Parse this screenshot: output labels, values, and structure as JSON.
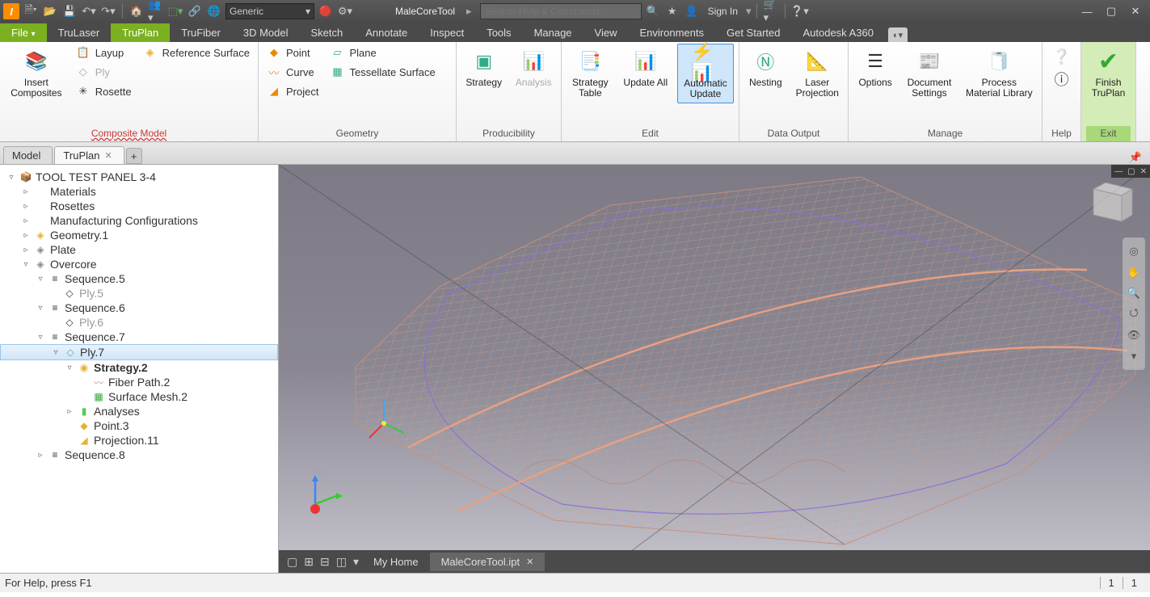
{
  "titlebar": {
    "material_dd": "Generic",
    "doc_title": "MaleCoreTool",
    "search_ph": "Search Help & Commands...",
    "signin": "Sign In"
  },
  "menu": {
    "file": "File",
    "tabs": [
      "TruLaser",
      "TruPlan",
      "TruFiber",
      "3D Model",
      "Sketch",
      "Annotate",
      "Inspect",
      "Tools",
      "Manage",
      "View",
      "Environments",
      "Get Started",
      "Autodesk A360"
    ],
    "active_idx": 1
  },
  "ribbon": {
    "panels": [
      {
        "title": "Composite Model",
        "under": true,
        "items": {
          "insert": "Insert\nComposites",
          "layup": "Layup",
          "refsurf": "Reference Surface",
          "ply": "Ply",
          "rosette": "Rosette"
        }
      },
      {
        "title": "Geometry",
        "items": {
          "point": "Point",
          "plane": "Plane",
          "curve": "Curve",
          "tess": "Tessellate Surface",
          "project": "Project"
        }
      },
      {
        "title": "Producibility",
        "items": {
          "strategy": "Strategy",
          "analysis": "Analysis"
        }
      },
      {
        "title": "Edit",
        "items": {
          "stable": "Strategy\nTable",
          "updall": "Update All",
          "auto": "Automatic\nUpdate"
        }
      },
      {
        "title": "Data Output",
        "items": {
          "nest": "Nesting",
          "laser": "Laser\nProjection"
        }
      },
      {
        "title": "Manage",
        "items": {
          "opts": "Options",
          "docset": "Document\nSettings",
          "matlib": "Process\nMaterial Library"
        }
      },
      {
        "title": "Help"
      },
      {
        "title": "Exit",
        "items": {
          "finish": "Finish\nTruPlan"
        }
      }
    ]
  },
  "doctabs": {
    "model": "Model",
    "truplan": "TruPlan"
  },
  "tree": [
    {
      "d": 0,
      "e": "▿",
      "i": "📦",
      "t": "TOOL TEST PANEL 3-4",
      "bold": false
    },
    {
      "d": 1,
      "e": "▹",
      "i": "",
      "t": "Materials"
    },
    {
      "d": 1,
      "e": "▹",
      "i": "",
      "t": "Rosettes"
    },
    {
      "d": 1,
      "e": "▹",
      "i": "",
      "t": "Manufacturing Configurations"
    },
    {
      "d": 1,
      "e": "▹",
      "i": "◈",
      "t": "Geometry.1",
      "ic": "#e8b030"
    },
    {
      "d": 1,
      "e": "▹",
      "i": "◈",
      "t": "Plate",
      "ic": "#888"
    },
    {
      "d": 1,
      "e": "▿",
      "i": "◈",
      "t": "Overcore",
      "ic": "#888"
    },
    {
      "d": 2,
      "e": "▿",
      "i": "≡",
      "t": "Sequence.5"
    },
    {
      "d": 3,
      "e": "",
      "i": "◇",
      "t": "Ply.5",
      "dim": true
    },
    {
      "d": 2,
      "e": "▿",
      "i": "≡",
      "t": "Sequence.6"
    },
    {
      "d": 3,
      "e": "",
      "i": "◇",
      "t": "Ply.6",
      "dim": true
    },
    {
      "d": 2,
      "e": "▿",
      "i": "≡",
      "t": "Sequence.7"
    },
    {
      "d": 3,
      "e": "▿",
      "i": "◇",
      "t": "Ply.7",
      "sel": true,
      "ic": "#5aa"
    },
    {
      "d": 4,
      "e": "▿",
      "i": "◉",
      "t": "Strategy.2",
      "bold": true,
      "ic": "#e8b030"
    },
    {
      "d": 5,
      "e": "",
      "i": "〰",
      "t": "Fiber Path.2",
      "ic": "#d88"
    },
    {
      "d": 5,
      "e": "",
      "i": "▦",
      "t": "Surface Mesh.2",
      "ic": "#3a3"
    },
    {
      "d": 4,
      "e": "▹",
      "i": "▮",
      "t": "Analyses",
      "ic": "#5c5"
    },
    {
      "d": 4,
      "e": "",
      "i": "◆",
      "t": "Point.3",
      "ic": "#e8b030"
    },
    {
      "d": 4,
      "e": "",
      "i": "◢",
      "t": "Projection.11",
      "ic": "#e8b030"
    },
    {
      "d": 2,
      "e": "▹",
      "i": "≡",
      "t": "Sequence.8"
    }
  ],
  "bottomtabs": {
    "home": "My Home",
    "doc": "MaleCoreTool.ipt"
  },
  "status": {
    "help": "For Help, press F1",
    "n1": "1",
    "n2": "1"
  }
}
